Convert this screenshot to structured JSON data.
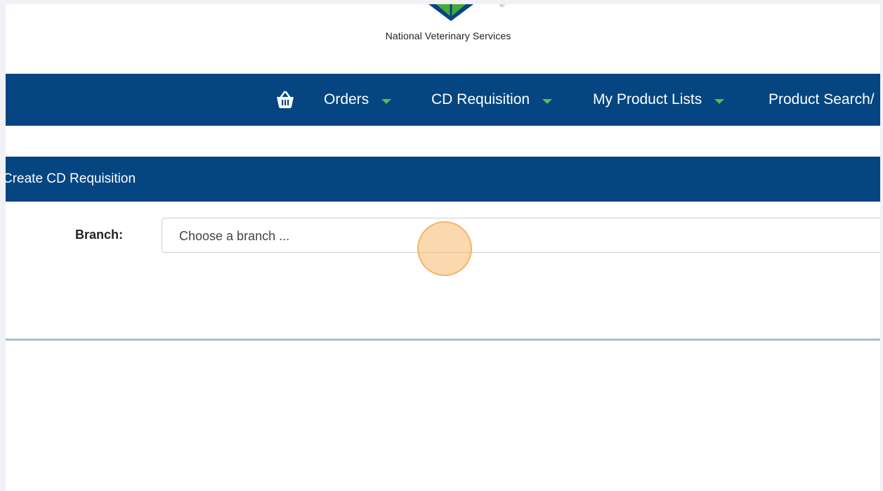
{
  "brand": {
    "name": "National Veterinary Services",
    "registered_mark": "®"
  },
  "nav": {
    "basket_icon": "basket-icon",
    "items": [
      {
        "label": "Orders"
      },
      {
        "label": "CD Requisition"
      },
      {
        "label": "My Product Lists"
      },
      {
        "label": "Product Search/"
      }
    ],
    "caret_color": "#5fb94a",
    "background": "#054581"
  },
  "section": {
    "title": "Create CD Requisition"
  },
  "form": {
    "branch_label": "Branch:",
    "branch_placeholder": "Choose a branch ..."
  }
}
